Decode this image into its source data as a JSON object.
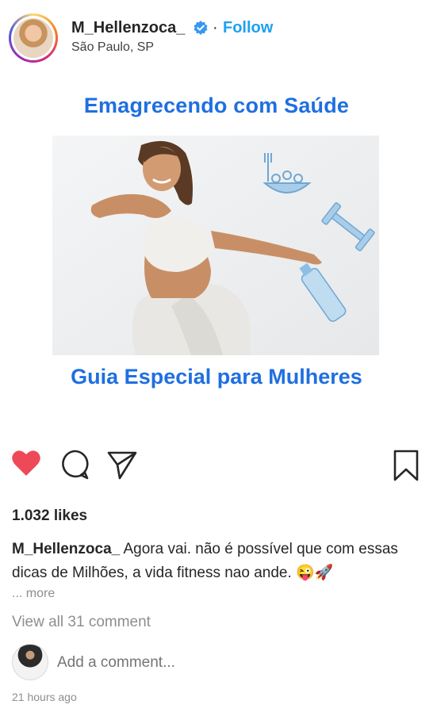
{
  "header": {
    "username": "M_Hellenzoca_",
    "separator": "·",
    "follow_label": "Follow",
    "location": "São Paulo, SP",
    "verified_icon": "verified-badge-icon"
  },
  "post": {
    "title": "Emagrecendo com Saúde",
    "subtitle": "Guia Especial para Mulheres"
  },
  "actions": {
    "like_icon": "heart-icon",
    "comment_icon": "comment-icon",
    "share_icon": "send-icon",
    "save_icon": "bookmark-icon",
    "like_color": "#ed4956"
  },
  "likes": "1.032 likes",
  "caption": {
    "username": "M_Hellenzoca_",
    "text": "Agora vai. não é possível que com essas dicas de Milhões, a vida fitness nao ande. 😜🚀"
  },
  "more_label": "... more",
  "view_comments_label": "View all 31 comment",
  "comment": {
    "placeholder": "Add a comment..."
  },
  "timestamp": "21 hours ago",
  "colors": {
    "accent": "#1da1f2",
    "title_blue": "#1f6fe0",
    "muted": "#8e8e8e"
  }
}
